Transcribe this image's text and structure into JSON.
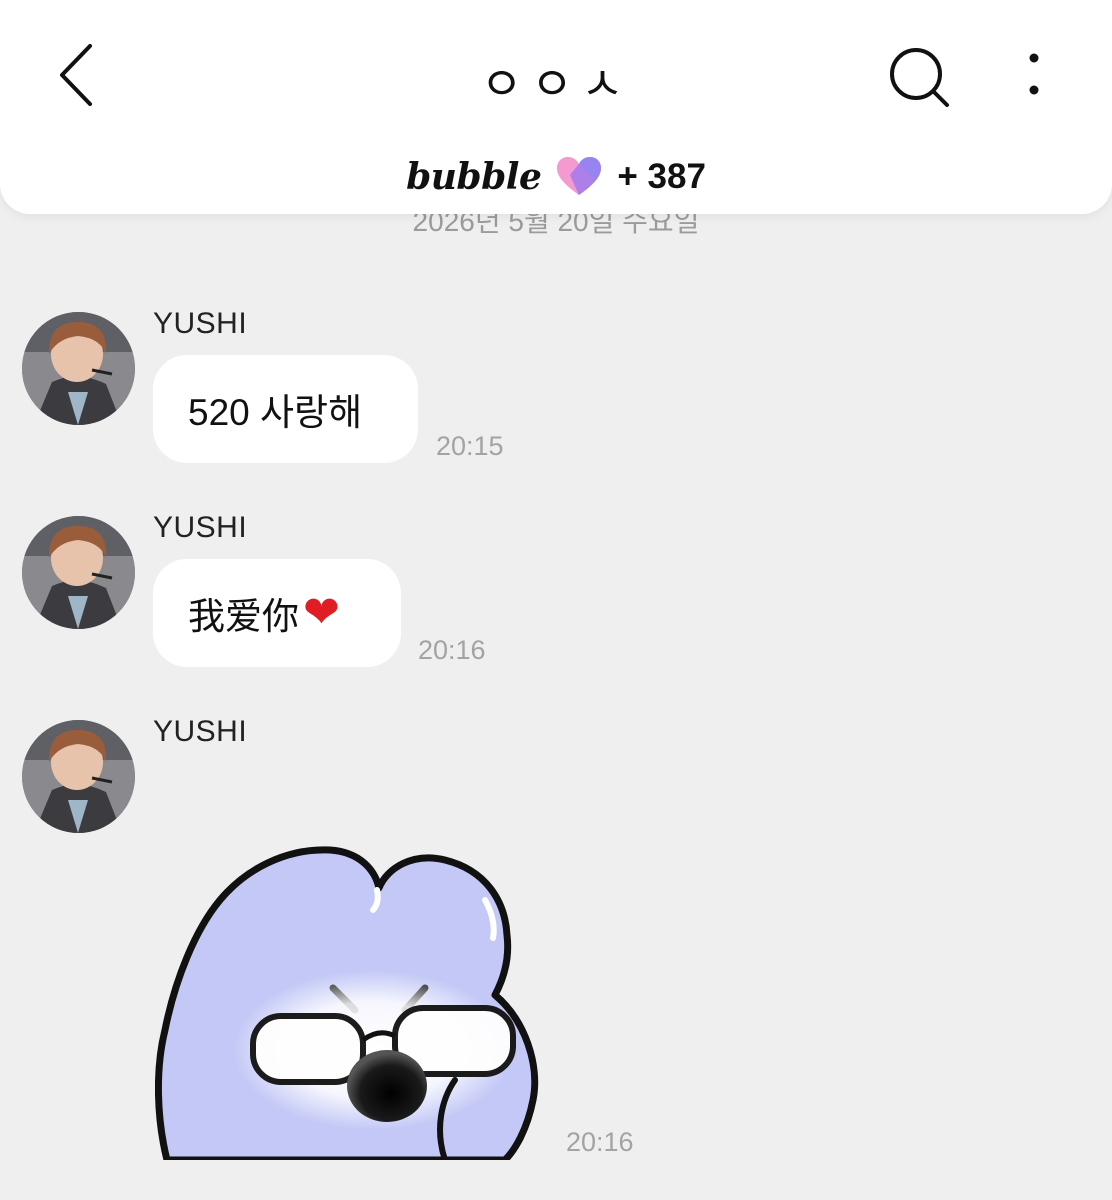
{
  "header": {
    "title": "ㅇㅇㅅ",
    "brand": "bubble",
    "count": "+ 387",
    "icons": {
      "back": "chevron-left-icon",
      "search": "search-icon",
      "more": "more-vertical-icon",
      "heart": "bubble-heart-icon"
    },
    "heart_colors": [
      "#f39ad1",
      "#8f82f2"
    ]
  },
  "date_divider": "2026년 5월 20일 수요일",
  "messages": [
    {
      "sender": "YUSHI",
      "text": "520 사랑해",
      "time": "20:15"
    },
    {
      "sender": "YUSHI",
      "text": "我爱你",
      "emoji": "❤",
      "time": "20:16"
    },
    {
      "sender": "YUSHI",
      "sticker": "blue-creature-sunglasses-sticker",
      "time": "20:16"
    }
  ],
  "colors": {
    "background": "#efefef",
    "bubble": "#ffffff",
    "time": "#a3a3a3",
    "sticker_fill": "#c3c8f6"
  }
}
